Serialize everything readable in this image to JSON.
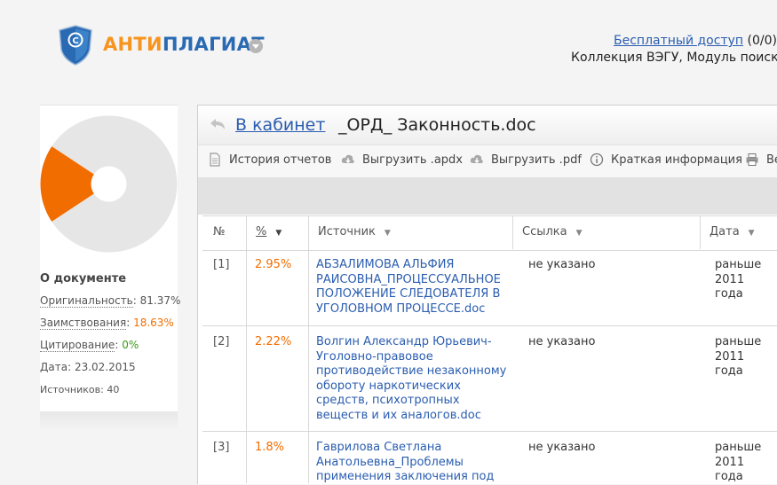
{
  "header": {
    "logo_part1": "АНТИ",
    "logo_part2": "ПЛАГИАТ",
    "free_access_link": "Бесплатный доступ",
    "free_access_count": " (0/0)",
    "collection_text": "Коллекция ВЭГУ, Модуль поиск"
  },
  "colors": {
    "brand_orange": "#f7941e",
    "brand_blue": "#2a6ab3",
    "borrowing": "#f26d00",
    "citation": "#3a9a17",
    "originality_pie": "#e6e6e6"
  },
  "summary": {
    "title": "О документе",
    "originality_label": "Оригинальность",
    "originality_value": "81.37%",
    "borrowing_label": "Заимствования",
    "borrowing_value": "18.63%",
    "citation_label": "Цитирование",
    "citation_value": "0%",
    "date_label": "Дата",
    "date_value": "23.02.2015",
    "sources_label": "Источников",
    "sources_value": "40",
    "pie": {
      "originality": 81.37,
      "borrowing": 18.63,
      "citation": 0
    }
  },
  "report": {
    "back_link": "В кабинет",
    "document_name": "_ОРД_ Законность.doc"
  },
  "toolbar": {
    "history": "История отчетов",
    "export_apdx": "Выгрузить .apdx",
    "export_pdf": "Выгрузить .pdf",
    "brief_info": "Краткая информация",
    "print": "Ве"
  },
  "icons": {
    "back": "back-arrow-icon",
    "history": "document-icon",
    "export_apdx": "cloud-download-icon",
    "export_pdf": "cloud-download-icon",
    "info": "info-icon",
    "print": "printer-icon",
    "logo": "shield-copyright-icon",
    "logo_menu": "chevron-down-icon"
  },
  "table": {
    "columns": {
      "num": "№",
      "pct": "%",
      "source": "Источник",
      "link": "Ссылка",
      "date": "Дата"
    },
    "rows": [
      {
        "num": "[1]",
        "pct": "2.95%",
        "source_lines": [
          "АБЗАЛИМОВА АЛЬФИЯ",
          "РАИСОВНА_ПРОЦЕССУАЛЬНОЕ",
          "ПОЛОЖЕНИЕ СЛЕДОВАТЕЛЯ В",
          "УГОЛОВНОМ ПРОЦЕССЕ.doc"
        ],
        "link": "не указано",
        "date_lines": [
          "раньше 2011",
          "года"
        ]
      },
      {
        "num": "[2]",
        "pct": "2.22%",
        "source_lines": [
          "Волгин Александр Юрьевич-",
          "Уголовно-правовое",
          "противодействие незаконному",
          "обороту наркотических",
          "средств, психотропных",
          "веществ и их аналогов.doc"
        ],
        "link": "не указано",
        "date_lines": [
          "раньше 2011",
          "года"
        ]
      },
      {
        "num": "[3]",
        "pct": "1.8%",
        "source_lines": [
          "Гаврилова Светлана",
          "Анатольевна_Проблемы",
          "применения заключения под"
        ],
        "link": "не указано",
        "date_lines": [
          "раньше 2011",
          "года"
        ]
      }
    ]
  }
}
